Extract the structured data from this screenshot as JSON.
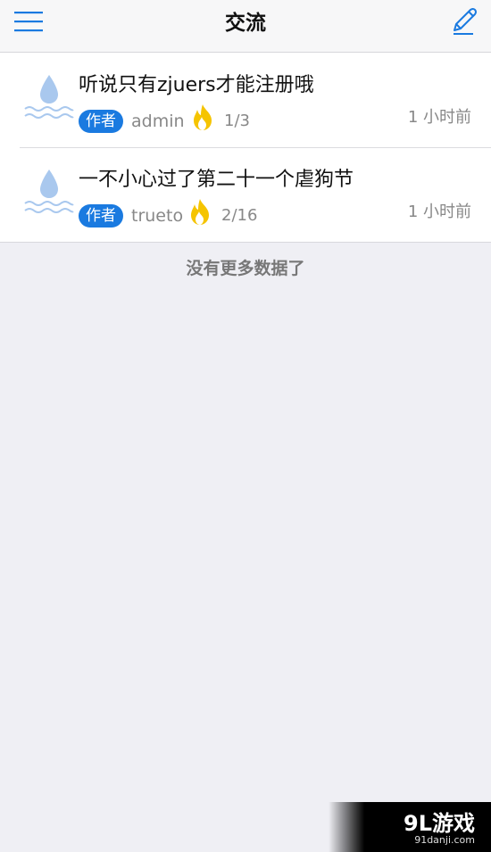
{
  "header": {
    "title": "交流",
    "menu_icon": "hamburger-menu-icon",
    "edit_icon": "pencil-edit-icon"
  },
  "posts": [
    {
      "title": "听说只有zjuers才能注册哦",
      "badge": "作者",
      "author": "admin",
      "count": "1/3",
      "time": "1 小时前",
      "avatar_icon": "water-drop-icon",
      "hot_icon": "fire-icon"
    },
    {
      "title": "一不小心过了第二十一个虐狗节",
      "badge": "作者",
      "author": "trueto",
      "count": "2/16",
      "time": "1 小时前",
      "avatar_icon": "water-drop-icon",
      "hot_icon": "fire-icon"
    }
  ],
  "footer": {
    "no_more": "没有更多数据了"
  },
  "watermark": {
    "logo": "9L游戏",
    "site": "91danji.com"
  },
  "colors": {
    "accent": "#1a7ae0",
    "badge_bg": "#1a7ae0",
    "fire": "#f5c400",
    "drop": "#a9c8ee",
    "page_bg": "#efeff4"
  }
}
